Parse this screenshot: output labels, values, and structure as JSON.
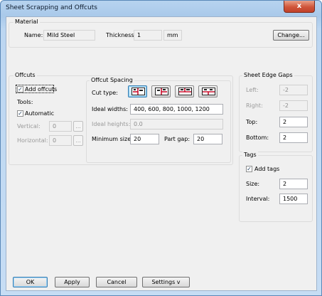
{
  "window": {
    "title": "Sheet Scrapping and Offcuts",
    "close_label": "x"
  },
  "material": {
    "group_title": "Material",
    "name_label": "Name:",
    "name_value": "Mild Steel",
    "thickness_label": "Thickness:",
    "thickness_value": "1",
    "unit": "mm",
    "change_label": "Change..."
  },
  "offcuts": {
    "group_title": "Offcuts",
    "add_offcuts_label": "Add offcuts",
    "add_offcuts_checked": true,
    "tools_label": "Tools:",
    "automatic_label": "Automatic",
    "automatic_checked": true,
    "vertical_label": "Vertical:",
    "vertical_value": "0",
    "horizontal_label": "Horizontal:",
    "horizontal_value": "0",
    "browse_label": "..."
  },
  "spacing": {
    "group_title": "Offcut Spacing",
    "cut_type_label": "Cut type:",
    "cut_type_icons": [
      "cut-type-1-icon",
      "cut-type-2-icon",
      "cut-type-3-icon",
      "cut-type-4-icon"
    ],
    "ideal_widths_label": "Ideal widths:",
    "ideal_widths_value": "400, 600, 800, 1000, 1200",
    "ideal_heights_label": "Ideal heights:",
    "ideal_heights_value": "0.0",
    "min_size_label": "Minimum size:",
    "min_size_value": "20",
    "part_gap_label": "Part gap:",
    "part_gap_value": "20"
  },
  "edge_gaps": {
    "group_title": "Sheet Edge Gaps",
    "left_label": "Left:",
    "left_value": "-2",
    "right_label": "Right:",
    "right_value": "-2",
    "top_label": "Top:",
    "top_value": "2",
    "bottom_label": "Bottom:",
    "bottom_value": "2"
  },
  "tags": {
    "group_title": "Tags",
    "add_tags_label": "Add tags",
    "add_tags_checked": true,
    "size_label": "Size:",
    "size_value": "2",
    "interval_label": "Interval:",
    "interval_value": "1500"
  },
  "footer": {
    "ok_label": "OK",
    "apply_label": "Apply",
    "cancel_label": "Cancel",
    "settings_label": "Settings v"
  },
  "colors": {
    "title_bar": "#b7d3ef",
    "close_button": "#d0553a",
    "dialog_background": "#f0f0f0",
    "selected_accent": "#3c7fb1",
    "cut_icon_red": "#c8102e"
  }
}
